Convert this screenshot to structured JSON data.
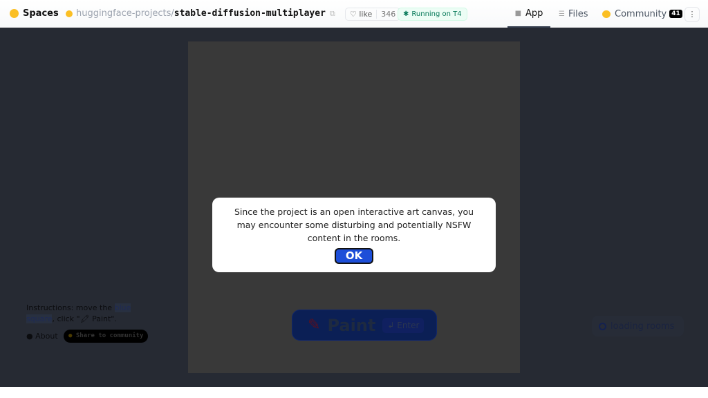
{
  "header": {
    "spaces_label": "Spaces",
    "org": "huggingface-projects",
    "separator": "/",
    "repo": "stable-diffusion-multiplayer",
    "like_label": "like",
    "like_count": "346",
    "status": "Running on T4"
  },
  "nav": {
    "app": "App",
    "files": "Files",
    "community": "Community",
    "community_count": "41",
    "more": "⋮"
  },
  "sidebar": {
    "instructions_prefix": "Instructions: move the ",
    "instructions_link": "blue square",
    "instructions_suffix": ", click \"🖍 Paint\".",
    "about": "About",
    "share": "Share to community"
  },
  "paint": {
    "label": "Paint",
    "shortcut": "↲ Enter"
  },
  "loading": {
    "label": "loading rooms"
  },
  "modal": {
    "message": "Since the project is an open interactive art canvas, you may encounter some disturbing and potentially NSFW content in the rooms.",
    "ok": "OK"
  }
}
